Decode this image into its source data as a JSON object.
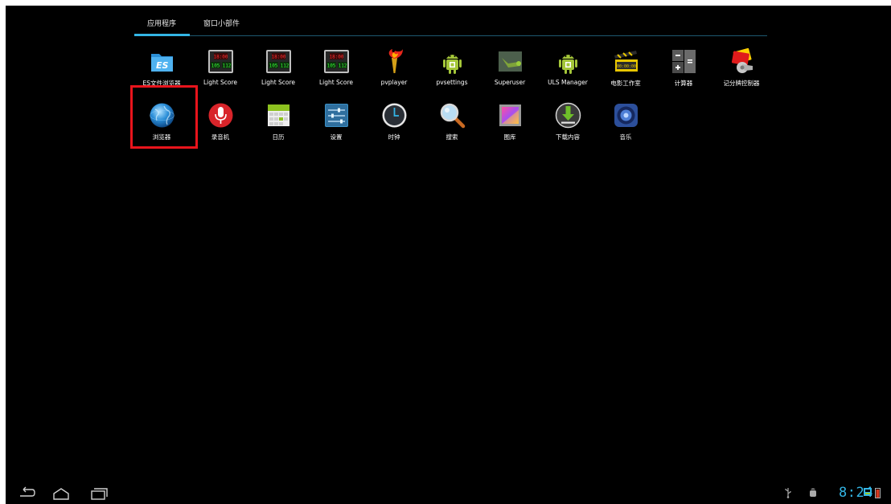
{
  "tabs": {
    "apps": "应用程序",
    "widgets": "窗口小部件"
  },
  "apps": [
    {
      "label": "ES文件浏览器",
      "icon": "es-file-explorer-icon"
    },
    {
      "label": "Light Score",
      "icon": "scoreboard-icon"
    },
    {
      "label": "Light Score",
      "icon": "scoreboard-icon"
    },
    {
      "label": "Light Score",
      "icon": "scoreboard-icon"
    },
    {
      "label": "pvplayer",
      "icon": "torch-icon"
    },
    {
      "label": "pvsettings",
      "icon": "android-icon"
    },
    {
      "label": "Superuser",
      "icon": "superuser-icon"
    },
    {
      "label": "ULS Manager",
      "icon": "android-icon"
    },
    {
      "label": "电影工作室",
      "icon": "clapperboard-icon"
    },
    {
      "label": "计算器",
      "icon": "calculator-icon"
    },
    {
      "label": "记分牌控制器",
      "icon": "whistle-icon"
    },
    {
      "label": "浏览器",
      "icon": "globe-icon"
    },
    {
      "label": "录音机",
      "icon": "microphone-icon"
    },
    {
      "label": "日历",
      "icon": "calendar-icon"
    },
    {
      "label": "设置",
      "icon": "settings-sliders-icon"
    },
    {
      "label": "时钟",
      "icon": "clock-icon"
    },
    {
      "label": "搜索",
      "icon": "magnifier-icon"
    },
    {
      "label": "图库",
      "icon": "gallery-icon"
    },
    {
      "label": "下载内容",
      "icon": "download-icon"
    },
    {
      "label": "音乐",
      "icon": "speaker-icon"
    }
  ],
  "scoreboard": {
    "time": "18:00",
    "score": "105",
    "score_right": "112"
  },
  "statusbar": {
    "time": "8:24"
  },
  "colors": {
    "accent": "#33b5e5",
    "highlight": "#e8141c",
    "background": "#000000"
  }
}
